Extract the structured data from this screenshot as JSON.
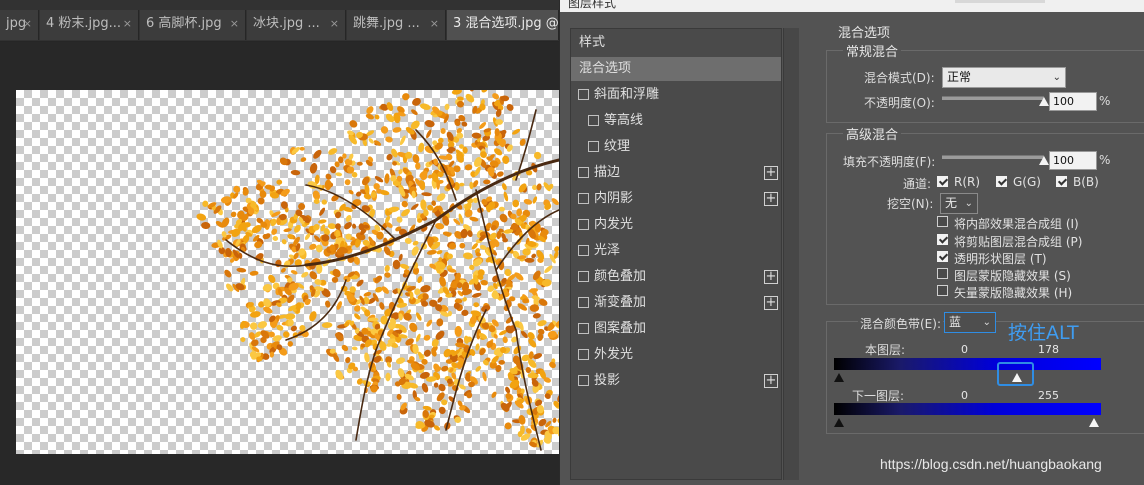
{
  "tabs": [
    {
      "label": "jpg",
      "close": "×"
    },
    {
      "label": "4 粉末.jpg...",
      "close": "×"
    },
    {
      "label": "6 高脚杯.jpg",
      "close": "×"
    },
    {
      "label": "冰块.jpg ...",
      "close": "×"
    },
    {
      "label": "跳舞.jpg ...",
      "close": "×"
    },
    {
      "label": "3 混合选项.jpg @",
      "close": ""
    }
  ],
  "dialog": {
    "title": "图层样式",
    "styles": [
      {
        "label": "样式",
        "checkbox": false,
        "plus": false
      },
      {
        "label": "混合选项",
        "checkbox": false,
        "plus": false,
        "selected": true
      },
      {
        "label": "斜面和浮雕",
        "checkbox": true,
        "plus": false
      },
      {
        "label": "等高线",
        "checkbox": true,
        "plus": false,
        "indent": true
      },
      {
        "label": "纹理",
        "checkbox": true,
        "plus": false,
        "indent": true
      },
      {
        "label": "描边",
        "checkbox": true,
        "plus": true
      },
      {
        "label": "内阴影",
        "checkbox": true,
        "plus": true
      },
      {
        "label": "内发光",
        "checkbox": true,
        "plus": false
      },
      {
        "label": "光泽",
        "checkbox": true,
        "plus": false
      },
      {
        "label": "颜色叠加",
        "checkbox": true,
        "plus": true
      },
      {
        "label": "渐变叠加",
        "checkbox": true,
        "plus": true
      },
      {
        "label": "图案叠加",
        "checkbox": true,
        "plus": false
      },
      {
        "label": "外发光",
        "checkbox": true,
        "plus": false
      },
      {
        "label": "投影",
        "checkbox": true,
        "plus": true
      }
    ],
    "plus_glyph": "+",
    "blend_options_title": "混合选项",
    "general": {
      "title": "常规混合",
      "blend_mode_label": "混合模式(D):",
      "blend_mode_value": "正常",
      "opacity_label": "不透明度(O):",
      "opacity_value": "100",
      "opacity_fraction": 1.0,
      "percent": "%"
    },
    "advanced": {
      "title": "高级混合",
      "fill_label": "填充不透明度(F):",
      "fill_value": "100",
      "fill_fraction": 1.0,
      "percent": "%",
      "channels_label": "通道:",
      "channels": [
        {
          "label": "R(R)",
          "checked": true
        },
        {
          "label": "G(G)",
          "checked": true
        },
        {
          "label": "B(B)",
          "checked": true
        }
      ],
      "knockout_label": "挖空(N):",
      "knockout_value": "无",
      "options": [
        {
          "label": "将内部效果混合成组 (I)",
          "checked": false
        },
        {
          "label": "将剪贴图层混合成组 (P)",
          "checked": true
        },
        {
          "label": "透明形状图层 (T)",
          "checked": true
        },
        {
          "label": "图层蒙版隐藏效果 (S)",
          "checked": false
        },
        {
          "label": "矢量蒙版隐藏效果 (H)",
          "checked": false
        }
      ]
    },
    "blend_if": {
      "label": "混合颜色带(E):",
      "value": "蓝",
      "this_layer_label": "本图层:",
      "this_layer_low": "0",
      "this_layer_high": "178",
      "underlying_label": "下一图层:",
      "underlying_low": "0",
      "underlying_high": "255"
    }
  },
  "annotation": "按住ALT",
  "watermark": "https://blog.csdn.net/huangbaokang",
  "icons": {
    "dropdown": "⌄",
    "close": "×"
  }
}
